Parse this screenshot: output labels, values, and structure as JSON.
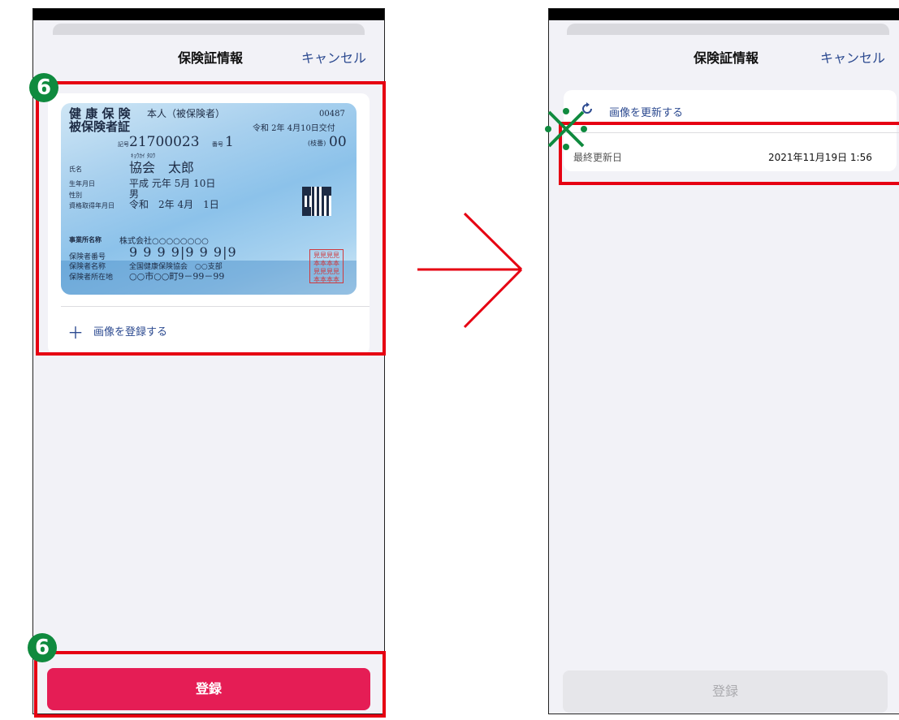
{
  "colors": {
    "accent_red": "#e51d55",
    "highlight_red": "#e60012",
    "badge_green": "#0f8a3e",
    "link_blue": "#2c4a90"
  },
  "left_screen": {
    "nav": {
      "title": "保険証情報",
      "cancel": "キャンセル"
    },
    "step_badge": "6",
    "card": {
      "title_line1": "健 康 保 険",
      "title_line2": "被保険者証",
      "person_type": "本人（被保険者）",
      "number_top": "00487",
      "issue_date": "令和 2年 4月10日交付",
      "kigo_label": "記号",
      "kigo": "21700023",
      "bango_label": "番号",
      "bango": "1",
      "edaban_label": "(枝番)",
      "edaban": "00",
      "furigana": "ｷｮｳｶｲ ﾀﾛｳ",
      "name_label": "氏名",
      "name": "協会　太郎",
      "birth_label": "生年月日",
      "birth": "平成 元年 5月 10日",
      "sex_label": "性別",
      "sex": "男",
      "qualification_label": "資格取得年月日",
      "qualification": "令和　2年 4月　1日",
      "office_label": "事業所名称",
      "office": "株式会社○○○○○○○○",
      "insurer_no_label": "保険者番号",
      "insurer_no": "9 9 9 9|9 9 9|9",
      "insurer_name_label": "保険者名称",
      "insurer_name": "全国健康保険協会　○○支部",
      "insurer_addr_label": "保険者所在地",
      "insurer_addr": "○○市○○町9－99－99",
      "stamp": "見見見見 本本本本 見見見見 本本本本"
    },
    "add_image": "画像を登録する",
    "register_button": "登録",
    "bottom_badge": "6"
  },
  "arrow": "arrow-right",
  "right_screen": {
    "nav": {
      "title": "保険証情報",
      "cancel": "キャンセル"
    },
    "update_image": "画像を更新する",
    "last_updated_label": "最終更新日",
    "last_updated_value": "2021年11月19日 1:56",
    "register_button": "登録"
  }
}
